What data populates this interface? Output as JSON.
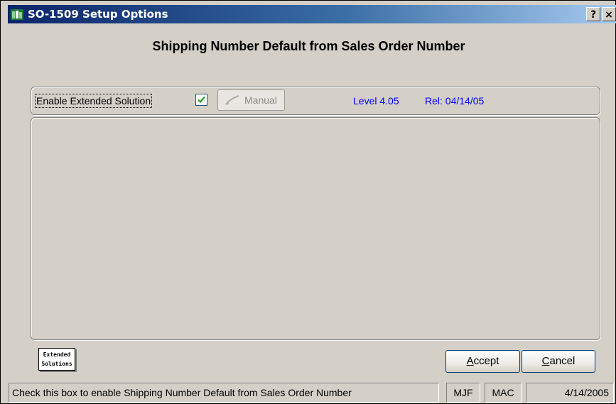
{
  "window": {
    "title": "SO-1509 Setup Options",
    "help_label": "?",
    "close_label": "×"
  },
  "heading": "Shipping Number Default from Sales Order Number",
  "options": {
    "enable_label": "Enable Extended Solution",
    "enable_checked": true,
    "manual_label": "Manual",
    "level": "Level 4.05",
    "release": "Rel: 04/14/05"
  },
  "logo": {
    "line1": "Extended",
    "line2": "Solutions"
  },
  "buttons": {
    "accept_mnemonic": "A",
    "accept_rest": "ccept",
    "cancel_mnemonic": "C",
    "cancel_rest": "ancel"
  },
  "statusbar": {
    "message": "Check this box to enable Shipping Number Default from Sales Order Number",
    "user": "MJF",
    "company": "MAC",
    "date": "4/14/2005"
  },
  "colors": {
    "title_start": "#0a246a",
    "title_end": "#a6caf0",
    "info_text": "#0000ff",
    "checkmark": "#21a121"
  }
}
